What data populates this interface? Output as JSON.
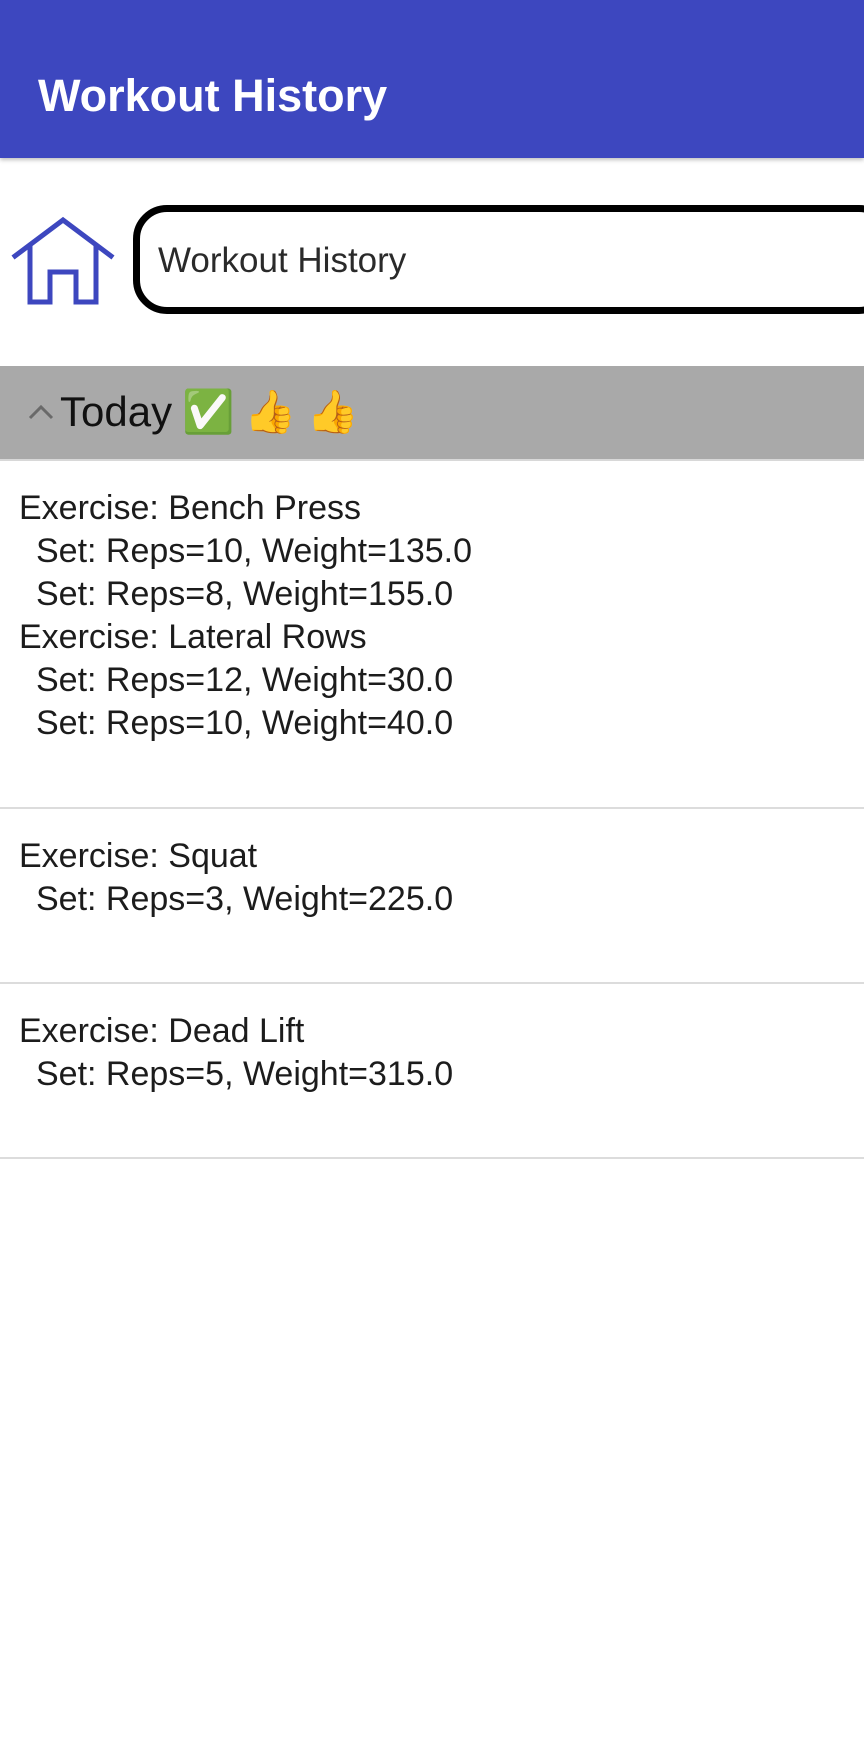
{
  "app_bar": {
    "title": "Workout History",
    "color": "#3d47bf"
  },
  "header_row": {
    "home_icon": "home-icon",
    "title_field_value": "Workout History"
  },
  "group": {
    "chevron_icon": "chevron-up-icon",
    "label": "Today",
    "emojis": [
      "✅",
      "👍",
      "👍"
    ],
    "background": "#a9a9a9"
  },
  "entries": [
    {
      "lines": [
        "Exercise: Bench Press",
        "Set: Reps=10, Weight=135.0",
        "Set: Reps=8, Weight=155.0",
        "Exercise: Lateral Rows",
        "Set: Reps=12, Weight=30.0",
        "Set: Reps=10, Weight=40.0"
      ]
    },
    {
      "lines": [
        "Exercise: Squat",
        "Set: Reps=3, Weight=225.0"
      ]
    },
    {
      "lines": [
        "Exercise: Dead Lift",
        "Set: Reps=5, Weight=315.0"
      ]
    }
  ]
}
